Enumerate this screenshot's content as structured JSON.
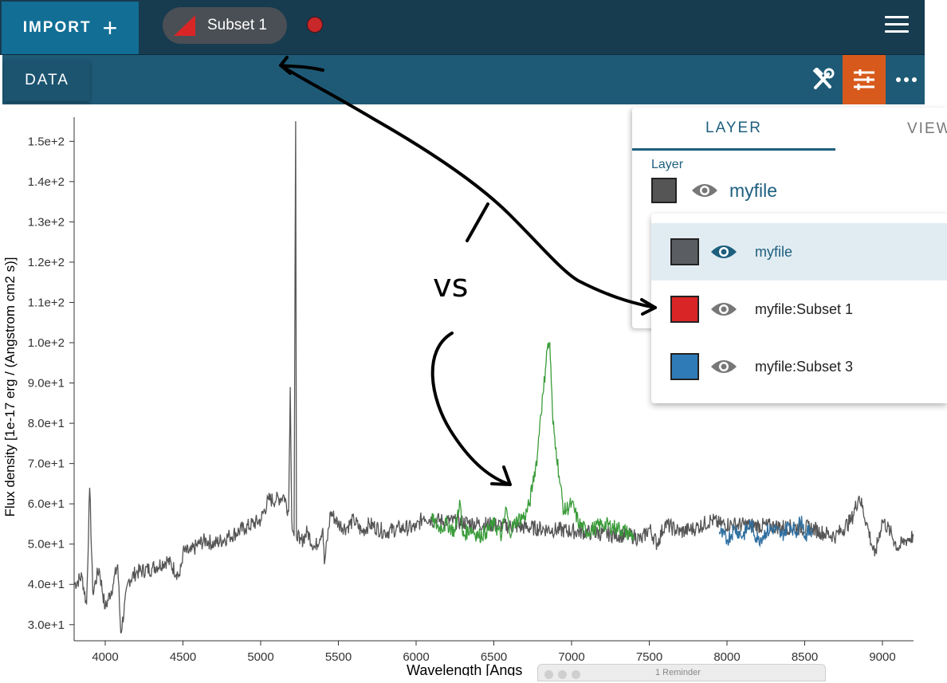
{
  "header": {
    "import_label": "IMPORT",
    "subset_chip_label": "Subset 1",
    "subset_dot_color": "#c8282a",
    "menu_icon": "hamburger-icon"
  },
  "toolbar": {
    "data_tab_label": "DATA",
    "tools": [
      "hammer-wrench-icon",
      "sliders-icon",
      "more-horizontal-icon"
    ],
    "active_tool_color": "#d75a1c"
  },
  "layer_panel": {
    "tabs": [
      {
        "label": "LAYER",
        "active": true
      },
      {
        "label": "VIEW"
      }
    ],
    "layer_label": "Layer",
    "selected_layer": {
      "name": "myfile",
      "color": "#555555"
    }
  },
  "dropdown": {
    "items": [
      {
        "name": "myfile",
        "color": "#5a5e62",
        "selected": true
      },
      {
        "name": "myfile:Subset 1",
        "color": "#d92525",
        "selected": false
      },
      {
        "name": "myfile:Subset 3",
        "color": "#2f7bb8",
        "selected": false
      }
    ]
  },
  "annotation": {
    "text": "vs"
  },
  "reminder": {
    "title": "1 Reminder"
  },
  "chart_data": {
    "type": "line",
    "xlabel": "Wavelength [Angs",
    "ylabel": "Flux density [1e-17 erg / (Angstrom cm2 s)]",
    "xlim": [
      3800,
      9200
    ],
    "ylim": [
      26,
      156
    ],
    "xticks": [
      4000,
      4500,
      5000,
      5500,
      6000,
      6500,
      7000,
      7500,
      8000,
      8500,
      9000
    ],
    "yticks": [
      30,
      40,
      50,
      60,
      70,
      80,
      90,
      100,
      110,
      120,
      130,
      140,
      150
    ],
    "ytick_labels": [
      "3.0e+1",
      "4.0e+1",
      "5.0e+1",
      "6.0e+1",
      "7.0e+1",
      "8.0e+1",
      "9.0e+1",
      "1.0e+2",
      "1.1e+2",
      "1.2e+2",
      "1.3e+2",
      "1.4e+2",
      "1.5e+2"
    ],
    "series": [
      {
        "color": "#555555",
        "x": [
          3800,
          3850,
          3880,
          3900,
          3920,
          3960,
          4000,
          4050,
          4080,
          4100,
          4150,
          4200,
          4300,
          4400,
          4480,
          4500,
          4550,
          4600,
          4650,
          4700,
          4800,
          4900,
          5000,
          5050,
          5100,
          5150,
          5180,
          5190,
          5200,
          5215,
          5225,
          5230,
          5240,
          5250,
          5300,
          5350,
          5400,
          5410,
          5450,
          5500,
          5550,
          5600,
          5650,
          5700,
          5800,
          5900,
          6000,
          6050,
          6100,
          7400,
          7450,
          7500,
          7550,
          7600,
          7700,
          7800,
          7900,
          7950,
          8550,
          8600,
          8700,
          8800,
          8850,
          8900,
          8950,
          9000,
          9050,
          9100,
          9150,
          9200
        ],
        "y": [
          40,
          42,
          35,
          64,
          38,
          44,
          34,
          40,
          45,
          28,
          41,
          43,
          44,
          46,
          42,
          48,
          48,
          50,
          51,
          50,
          52,
          54,
          56,
          61,
          61,
          62,
          58,
          89,
          56,
          52,
          155,
          52,
          53,
          50,
          53,
          49,
          54,
          45,
          58,
          55,
          54,
          56,
          53,
          55,
          53,
          54,
          54,
          57,
          56,
          52,
          51,
          54,
          50,
          55,
          53,
          54,
          56,
          55,
          54,
          53,
          52,
          56,
          62,
          55,
          47,
          56,
          53,
          49,
          51,
          52
        ]
      },
      {
        "color": "#3a9c3a",
        "x": [
          6100,
          6150,
          6200,
          6250,
          6280,
          6300,
          6350,
          6400,
          6450,
          6500,
          6550,
          6580,
          6600,
          6650,
          6700,
          6730,
          6750,
          6780,
          6800,
          6820,
          6840,
          6860,
          6870,
          6880,
          6900,
          6920,
          6950,
          7000,
          7050,
          7100,
          7150,
          7200,
          7300,
          7400
        ],
        "y": [
          56,
          54,
          55,
          53,
          61,
          52,
          54,
          52,
          53,
          55,
          52,
          59,
          53,
          56,
          57,
          60,
          65,
          72,
          82,
          88,
          98,
          100,
          90,
          80,
          74,
          67,
          58,
          60,
          55,
          53,
          54,
          55,
          54,
          52
        ]
      },
      {
        "color": "#2f6fa0",
        "x": [
          7950,
          8000,
          8050,
          8100,
          8150,
          8200,
          8250,
          8300,
          8350,
          8400,
          8450,
          8480,
          8500,
          8550
        ],
        "y": [
          53,
          51,
          54,
          52,
          55,
          51,
          53,
          54,
          52,
          55,
          53,
          57,
          52,
          54
        ]
      }
    ],
    "grid": false
  }
}
